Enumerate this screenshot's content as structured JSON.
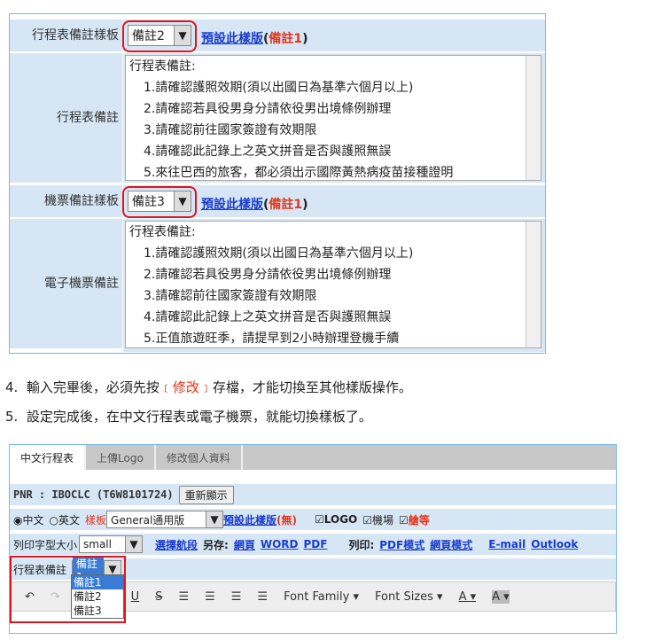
{
  "top": {
    "itinerary_template_label": "行程表備註樣板",
    "itinerary_template_value": "備註2",
    "set_default_link": "預設此樣版",
    "default_open": "(",
    "default_value": "備註1",
    "default_close": ")",
    "itinerary_notes_label": "行程表備註",
    "itinerary_notes": [
      "行程表備註:",
      "1.請確認護照效期(須以出國日為基準六個月以上)",
      "2.請確認若具役男身分請依役男出境條例辦理",
      "3.請確認前往國家簽證有效期限",
      "4.請確認此記錄上之英文拼音是否與護照無誤",
      "5.來往巴西的旅客，都必須出示國際黃熱病疫苗接種證明"
    ],
    "ticket_template_label": "機票備註樣板",
    "ticket_template_value": "備註3",
    "eticket_notes_label": "電子機票備註",
    "eticket_notes": [
      "行程表備註:",
      "1.請確認護照效期(須以出國日為基準六個月以上)",
      "2.請確認若具役男身分請依役男出境條例辦理",
      "3.請確認前往國家簽證有效期限",
      "4.請確認此記錄上之英文拼音是否與護照無誤",
      "5.正值旅遊旺季，請提早到2小時辦理登機手續"
    ]
  },
  "steps": [
    {
      "num": "4.",
      "pre": "輸入完畢後，必須先按",
      "hl": "﹝修改﹞",
      "post": "存檔，才能切換至其他樣版操作。"
    },
    {
      "num": "5.",
      "pre": "設定完成後，在中文行程表或電子機票，就能切換樣板了。"
    }
  ],
  "bottom": {
    "tabs": [
      "中文行程表",
      "上傳Logo",
      "修改個人資料"
    ],
    "pnr": "PNR : IBOCLC (T6W8101724)",
    "refresh": "重新顯示",
    "lang_zh": "中文",
    "lang_en": "英文",
    "template_label": "樣板",
    "template_value": "General通用版",
    "set_default": "預設此樣版",
    "none": "(無)",
    "logo": "LOGO",
    "airport": "機場",
    "cabin": "艙等",
    "font_size_label": "列印字型大小",
    "font_size": "small",
    "select_segment": "選擇航段",
    "save_as": "另存:",
    "web": "網頁",
    "word": "WORD",
    "pdf": "PDF",
    "print": "列印:",
    "pdf_mode": "PDF模式",
    "web_mode": "網頁模式",
    "email": "E-mail",
    "outlook": "Outlook",
    "notes_label": "行程表備註",
    "notes_value": "備註1",
    "options": [
      "備註1",
      "備註2",
      "備註3"
    ],
    "font_family": "Font Family",
    "font_sizes": "Font Sizes"
  },
  "colors": {
    "accent": "#1a3ccc",
    "highlight": "#e0141e",
    "row_bg": "#d6e6f5"
  }
}
